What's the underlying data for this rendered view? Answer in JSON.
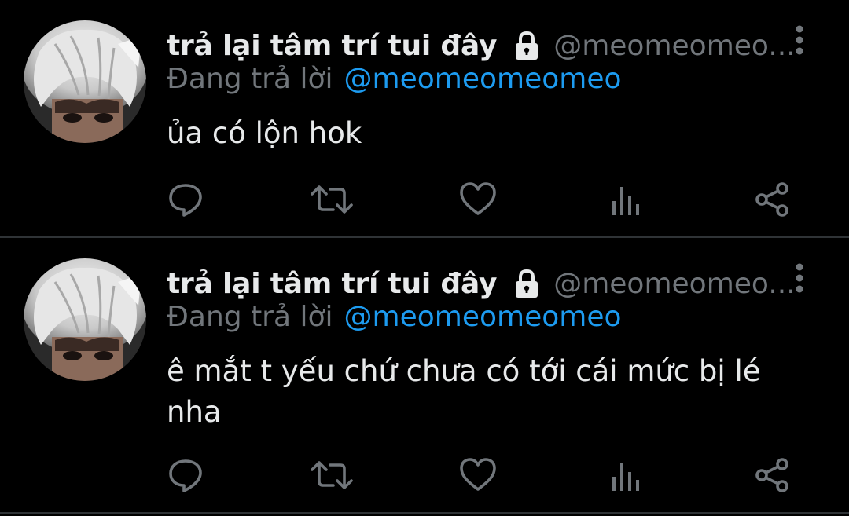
{
  "colors": {
    "background": "#000000",
    "text_primary": "#e7e9ea",
    "text_secondary": "#71767b",
    "link": "#1d9bf0",
    "divider": "#2f3336"
  },
  "tweets": [
    {
      "author": {
        "display_name": "trả lại tâm trí tui đây",
        "handle": "@meomeomeo...",
        "protected_icon": "lock-icon",
        "avatar_icon": "avatar"
      },
      "reply_prefix": "Đang trả lời",
      "reply_to": "@meomeomeomeo",
      "text": "ủa có lộn hok",
      "actions": [
        "reply-icon",
        "retweet-icon",
        "like-icon",
        "views-icon",
        "share-icon"
      ]
    },
    {
      "author": {
        "display_name": "trả lại tâm trí tui đây",
        "handle": "@meomeomeo...",
        "protected_icon": "lock-icon",
        "avatar_icon": "avatar"
      },
      "reply_prefix": "Đang trả lời",
      "reply_to": "@meomeomeomeo",
      "text": "ê mắt t yếu chứ chưa có tới cái mức bị lé nha",
      "actions": [
        "reply-icon",
        "retweet-icon",
        "like-icon",
        "views-icon",
        "share-icon"
      ]
    }
  ]
}
